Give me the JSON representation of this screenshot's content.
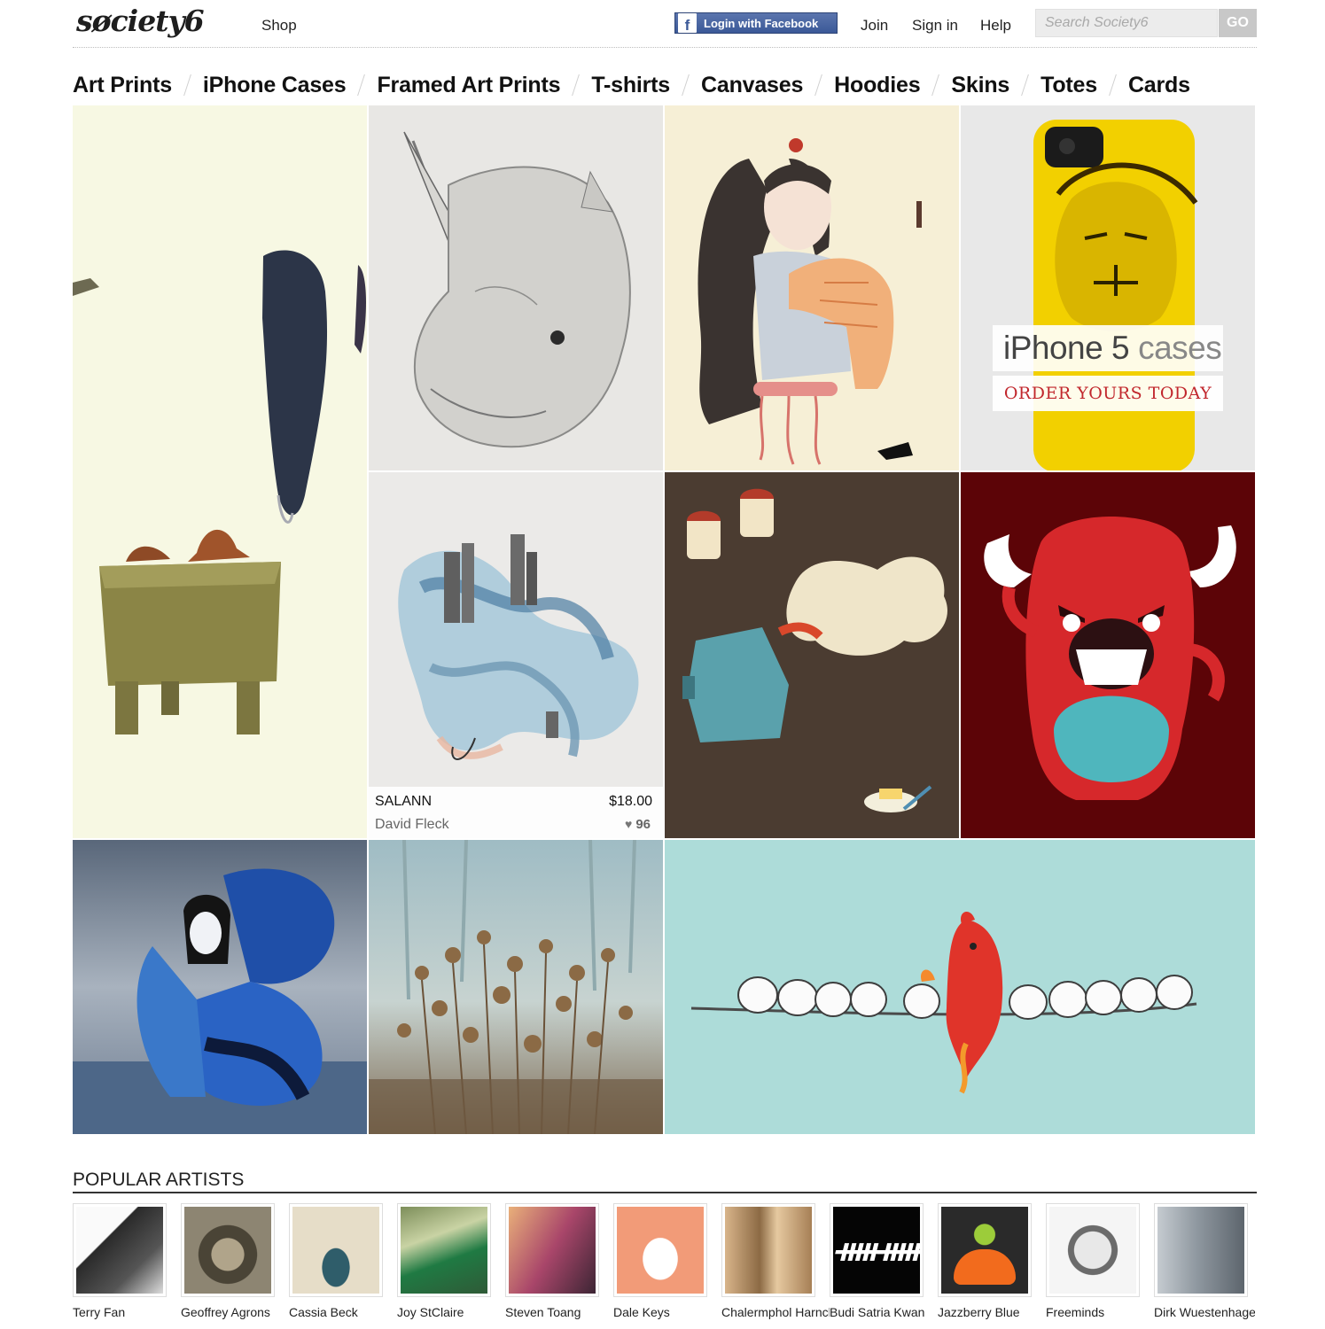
{
  "header": {
    "logo": "søciety6",
    "shop": "Shop",
    "facebook_login": "Login with Facebook",
    "facebook_glyph": "f",
    "join": "Join",
    "sign_in": "Sign in",
    "help": "Help",
    "search_placeholder": "Search Society6",
    "search_button": "GO"
  },
  "categories": [
    "Art Prints",
    "iPhone Cases",
    "Framed Art Prints",
    "T-shirts",
    "Canvases",
    "Hoodies",
    "Skins",
    "Totes",
    "Cards"
  ],
  "promo": {
    "headline_a": "iPhone 5",
    "headline_b": "cases",
    "cta": "ORDER YOURS TODAY"
  },
  "featured": {
    "title": "SALANN",
    "price": "$18.00",
    "artist": "David Fleck",
    "likes": "96"
  },
  "popular_artists": {
    "heading": "POPULAR ARTISTS",
    "artists": [
      {
        "name": "Terry Fan",
        "color": "#6d6d6d"
      },
      {
        "name": "Geoffrey Agrons",
        "color": "#7a7362"
      },
      {
        "name": "Cassia Beck",
        "color": "#d9d0bd"
      },
      {
        "name": "Joy StClaire",
        "color": "#3e7a4a"
      },
      {
        "name": "Steven Toang",
        "color": "#b05a6b"
      },
      {
        "name": "Dale Keys",
        "color": "#f39b78"
      },
      {
        "name": "Chalermphol Harnchakkham",
        "color": "#c9a57a"
      },
      {
        "name": "Budi Satria Kwan",
        "color": "#0a0a0a"
      },
      {
        "name": "Jazzberry Blue",
        "color": "#2a2a2a"
      },
      {
        "name": "Freeminds",
        "color": "#bdbdbd"
      },
      {
        "name": "Dirk Wuestenhagen",
        "color": "#8f98a0"
      }
    ]
  },
  "colors": {
    "facebook_blue": "#3b5998",
    "promo_red": "#c1272d"
  }
}
